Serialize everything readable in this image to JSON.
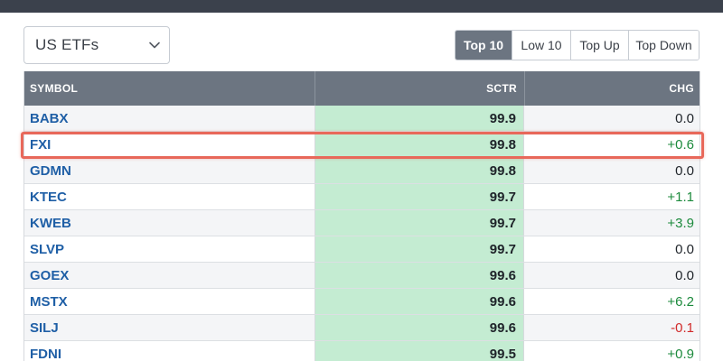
{
  "selector": {
    "value": "US ETFs"
  },
  "tabs": [
    {
      "label": "Top 10",
      "active": true
    },
    {
      "label": "Low 10",
      "active": false
    },
    {
      "label": "Top Up",
      "active": false
    },
    {
      "label": "Top Down",
      "active": false
    }
  ],
  "table": {
    "headers": {
      "symbol": "SYMBOL",
      "sctr": "SCTR",
      "chg": "CHG"
    },
    "rows": [
      {
        "symbol": "BABX",
        "sctr": "99.9",
        "chg": "0.0"
      },
      {
        "symbol": "FXI",
        "sctr": "99.8",
        "chg": "+0.6"
      },
      {
        "symbol": "GDMN",
        "sctr": "99.8",
        "chg": "0.0"
      },
      {
        "symbol": "KTEC",
        "sctr": "99.7",
        "chg": "+1.1"
      },
      {
        "symbol": "KWEB",
        "sctr": "99.7",
        "chg": "+3.9"
      },
      {
        "symbol": "SLVP",
        "sctr": "99.7",
        "chg": "0.0"
      },
      {
        "symbol": "GOEX",
        "sctr": "99.6",
        "chg": "0.0"
      },
      {
        "symbol": "MSTX",
        "sctr": "99.6",
        "chg": "+6.2"
      },
      {
        "symbol": "SILJ",
        "sctr": "99.6",
        "chg": "-0.1"
      },
      {
        "symbol": "FDNI",
        "sctr": "99.5",
        "chg": "+0.9"
      }
    ]
  },
  "colors": {
    "header_bg": "#6c7581",
    "sctr_bg": "#c4ecd2",
    "positive": "#1c8a3c",
    "negative": "#d12a2a",
    "link": "#1f5fa6",
    "highlight": "#e8685a"
  },
  "icons": {
    "dropdown": "chevron-down-icon"
  }
}
